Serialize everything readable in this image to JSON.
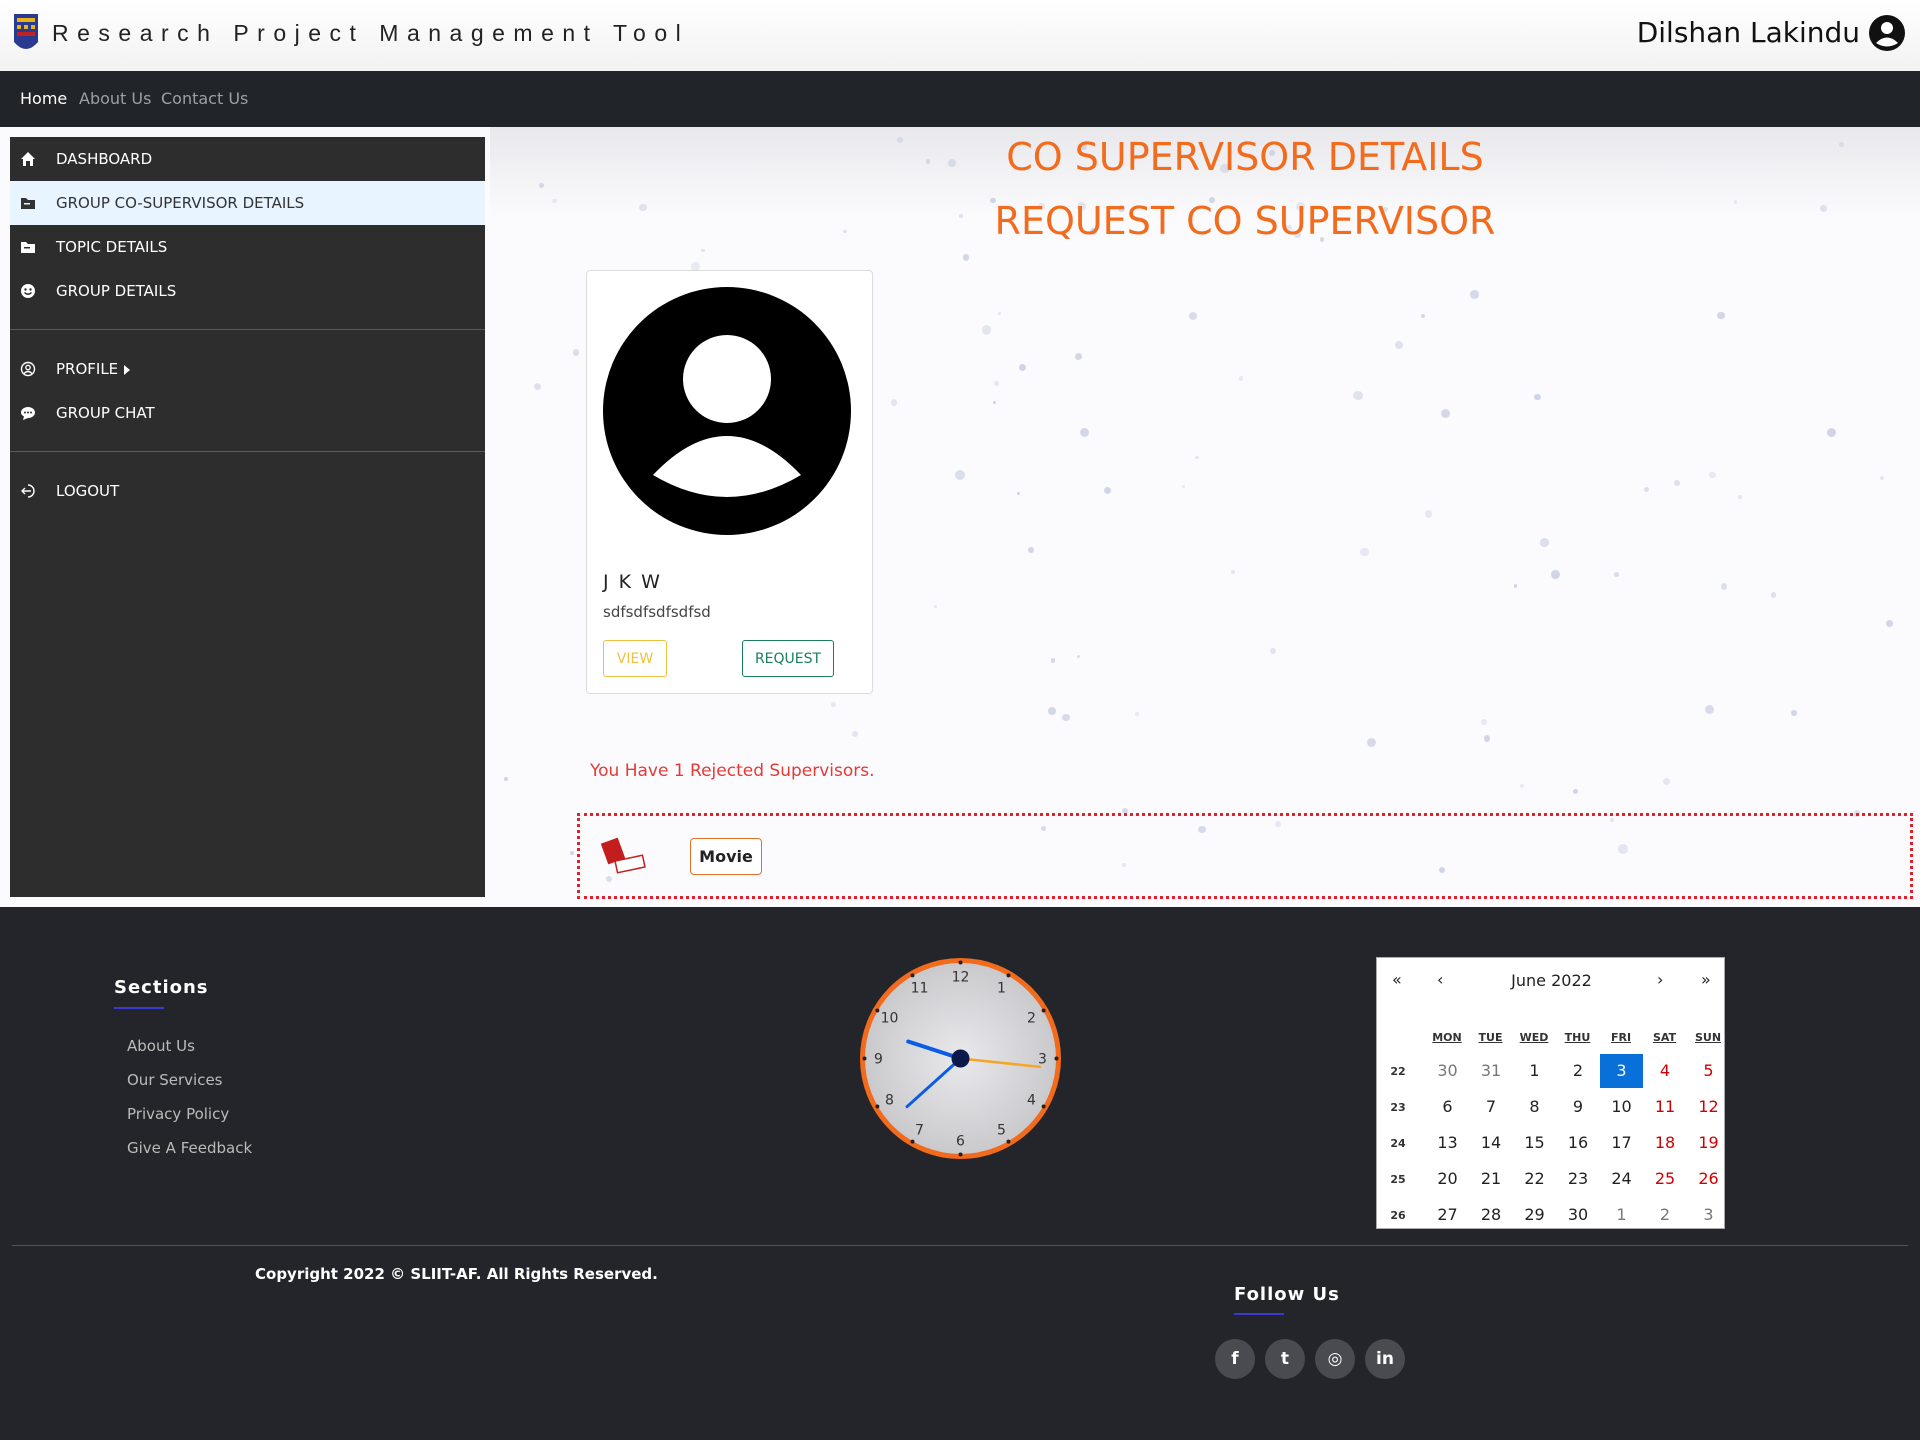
{
  "header": {
    "app_title": "Research Project Management Tool",
    "user_name": "Dilshan Lakindu"
  },
  "nav": {
    "items": [
      {
        "label": "Home",
        "active": true
      },
      {
        "label": "About Us"
      },
      {
        "label": "Contact Us"
      }
    ]
  },
  "sidebar": {
    "items": [
      {
        "label": "DASHBOARD",
        "icon": "home-icon"
      },
      {
        "label": "GROUP CO-SUPERVISOR DETAILS",
        "icon": "folder-icon",
        "active": true
      },
      {
        "label": "TOPIC DETAILS",
        "icon": "folder-icon"
      },
      {
        "label": "GROUP DETAILS",
        "icon": "smile-icon"
      },
      {
        "label": "PROFILE",
        "icon": "user-circle-icon"
      },
      {
        "label": "GROUP CHAT",
        "icon": "chat-icon"
      },
      {
        "label": "LOGOUT",
        "icon": "logout-icon"
      }
    ]
  },
  "main": {
    "heading1": "CO SUPERVISOR DETAILS",
    "heading2": "REQUEST CO SUPERVISOR",
    "card": {
      "name": "J K W",
      "description": "sdfsdfsdfsdfsd",
      "view_label": "VIEW",
      "request_label": "REQUEST"
    },
    "rejected_message": "You Have 1 Rejected Supervisors.",
    "rejected_item": {
      "label": "Movie",
      "icon": "rejected-stamp-icon"
    }
  },
  "footer": {
    "sections_title": "Sections",
    "links": [
      "About Us",
      "Our Services",
      "Privacy Policy",
      "Give A Feedback"
    ],
    "copyright": "Copyright 2022 © SLIIT-AF. All Rights Reserved.",
    "follow_title": "Follow Us",
    "social": [
      {
        "icon": "facebook-icon",
        "glyph": "f"
      },
      {
        "icon": "twitter-icon",
        "glyph": "t"
      },
      {
        "icon": "instagram-icon",
        "glyph": "◎"
      },
      {
        "icon": "linkedin-icon",
        "glyph": "in"
      }
    ],
    "clock": {
      "numbers": [
        "12",
        "1",
        "2",
        "3",
        "4",
        "5",
        "6",
        "7",
        "8",
        "9",
        "10",
        "11"
      ],
      "hour": 9.6,
      "minute": 38,
      "second": 16
    },
    "calendar": {
      "title": "June 2022",
      "nav": [
        "«",
        "‹",
        "›",
        "»"
      ],
      "days_of_week": [
        "MON",
        "TUE",
        "WED",
        "THU",
        "FRI",
        "SAT",
        "SUN"
      ],
      "weeks": [
        {
          "week": "22",
          "days": [
            "30",
            "31",
            "1",
            "2",
            "3",
            "4",
            "5"
          ]
        },
        {
          "week": "23",
          "days": [
            "6",
            "7",
            "8",
            "9",
            "10",
            "11",
            "12"
          ]
        },
        {
          "week": "24",
          "days": [
            "13",
            "14",
            "15",
            "16",
            "17",
            "18",
            "19"
          ]
        },
        {
          "week": "25",
          "days": [
            "20",
            "21",
            "22",
            "23",
            "24",
            "25",
            "26"
          ]
        },
        {
          "week": "26",
          "days": [
            "27",
            "28",
            "29",
            "30",
            "1",
            "2",
            "3"
          ]
        }
      ],
      "today": "3"
    }
  },
  "colors": {
    "accent": "#f36b1c",
    "navbar": "#212529",
    "sidebar": "#2d2d2d",
    "footer": "#24252a",
    "today": "#0a70d9",
    "rejected": "#e53935"
  }
}
